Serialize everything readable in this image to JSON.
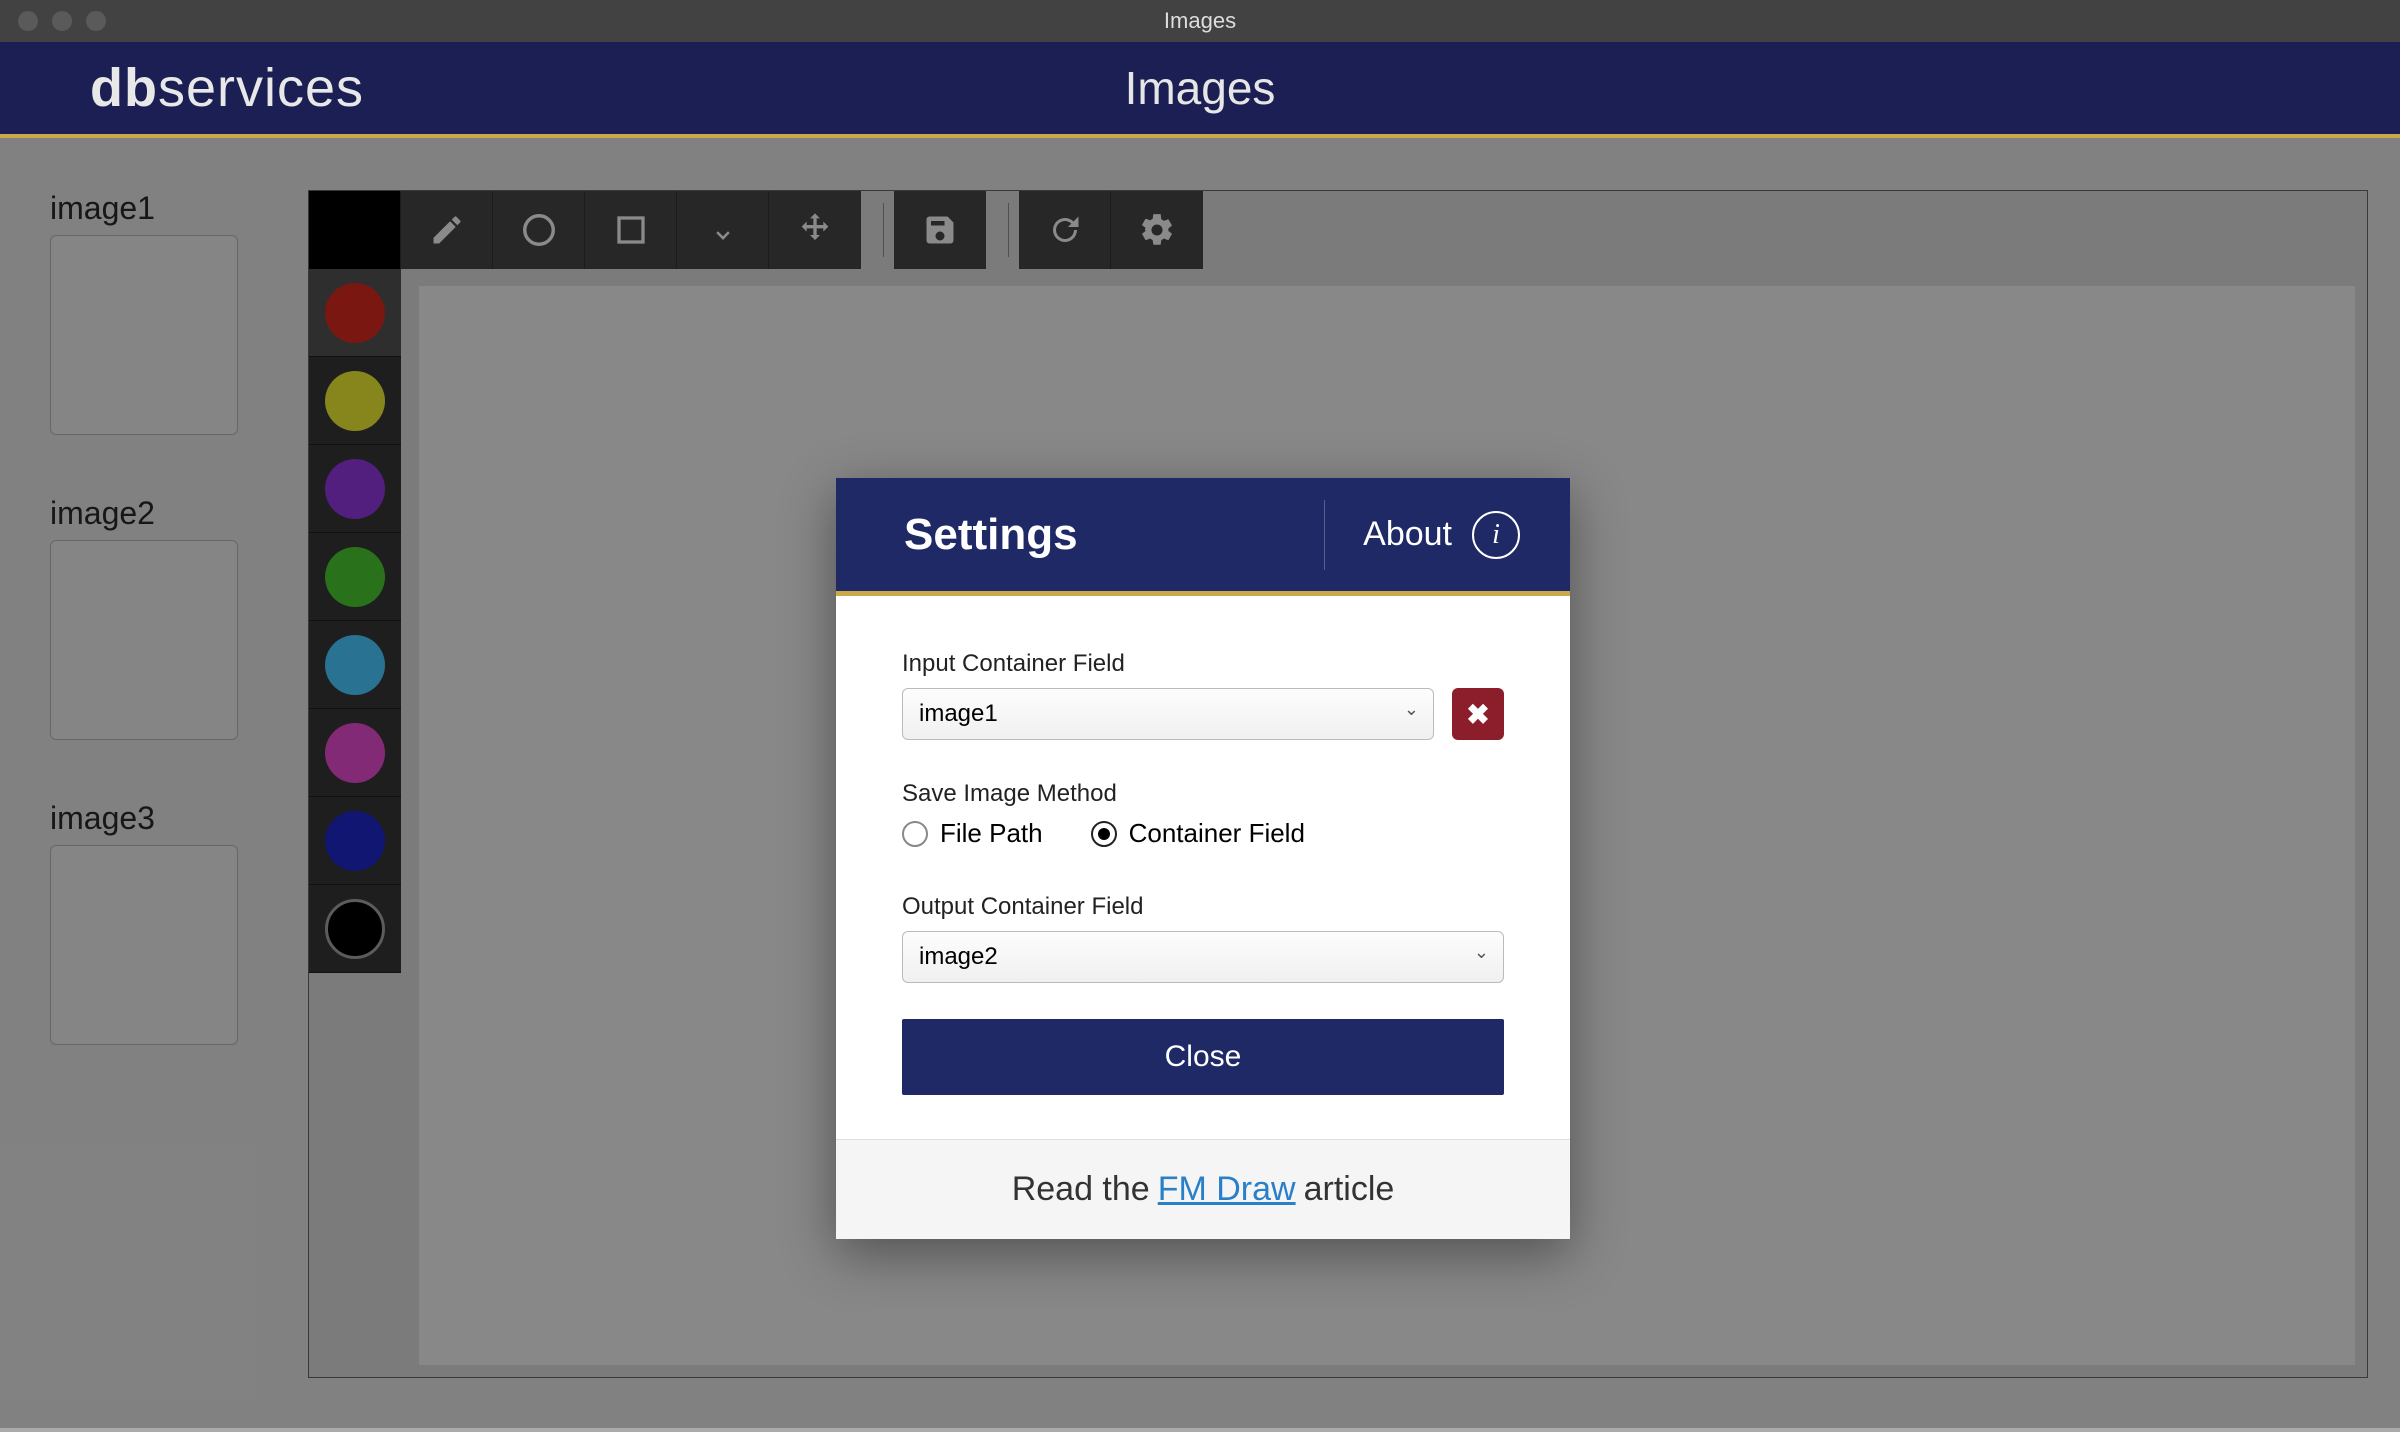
{
  "window": {
    "title": "Images"
  },
  "header": {
    "brand_prefix": "db",
    "brand_rest": "services",
    "title": "Images"
  },
  "sidebar": {
    "items": [
      {
        "label": "image1"
      },
      {
        "label": "image2"
      },
      {
        "label": "image3"
      }
    ]
  },
  "palette": {
    "colors": [
      "#b5221a",
      "#c6c62c",
      "#7b2fba",
      "#3fa729",
      "#3fa8d6",
      "#c23fb0",
      "#1921a8",
      "#000000"
    ],
    "selected_index": 0
  },
  "modal": {
    "title": "Settings",
    "about_label": "About",
    "input_label": "Input Container Field",
    "input_value": "image1",
    "save_method_label": "Save Image Method",
    "radio_file_path": "File Path",
    "radio_container": "Container Field",
    "selected_method": "container",
    "output_label": "Output Container Field",
    "output_value": "image2",
    "close_label": "Close",
    "footer_pre": "Read the ",
    "footer_link": "FM Draw",
    "footer_post": " article"
  }
}
